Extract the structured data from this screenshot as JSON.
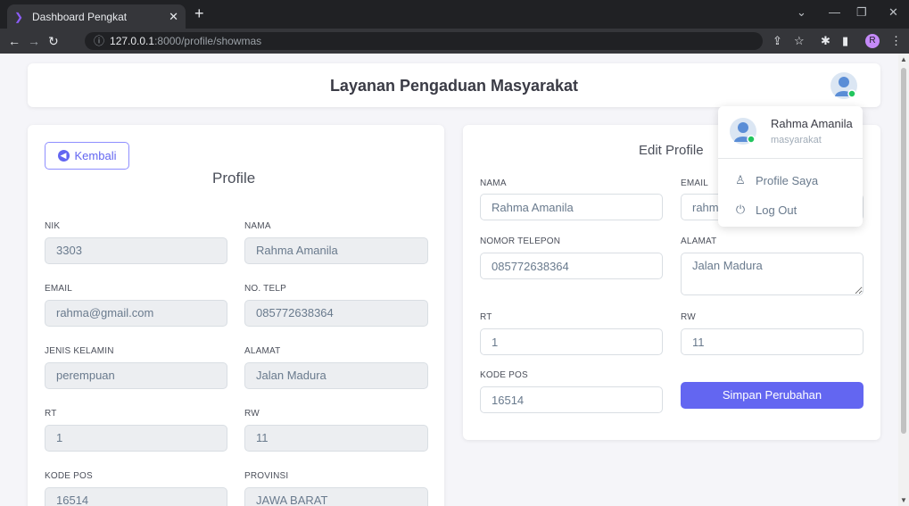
{
  "browser": {
    "tab_title": "Dashboard Pengkat",
    "url_host": "127.0.0.1",
    "url_path": ":8000/profile/showmas",
    "profile_initial": "R"
  },
  "navbar": {
    "title": "Layanan Pengaduan Masyarakat"
  },
  "profile_card": {
    "back_label": "Kembali",
    "title": "Profile",
    "fields": {
      "nik_label": "NIK",
      "nik": "3303",
      "nama_label": "NAMA",
      "nama": "Rahma Amanila",
      "email_label": "EMAIL",
      "email": "rahma@gmail.com",
      "telp_label": "NO. TELP",
      "telp": "085772638364",
      "jk_label": "JENIS KELAMIN",
      "jk": "perempuan",
      "alamat_label": "ALAMAT",
      "alamat": "Jalan Madura",
      "rt_label": "RT",
      "rt": "1",
      "rw_label": "RW",
      "rw": "11",
      "kodepos_label": "KODE POS",
      "kodepos": "16514",
      "provinsi_label": "PROVINSI",
      "provinsi": "JAWA BARAT"
    }
  },
  "edit_card": {
    "title": "Edit Profile",
    "nama_label": "NAMA",
    "nama": "Rahma Amanila",
    "email_label": "EMAIL",
    "email": "rahma@gmail.com",
    "telp_label": "NOMOR TELEPON",
    "telp": "085772638364",
    "alamat_label": "ALAMAT",
    "alamat": "Jalan Madura",
    "rt_label": "RT",
    "rt": "1",
    "rw_label": "RW",
    "rw": "11",
    "kodepos_label": "KODE POS",
    "kodepos": "16514",
    "save_label": "Simpan Perubahan"
  },
  "dropdown": {
    "name": "Rahma Amanila",
    "role": "masyarakat",
    "items": [
      {
        "label": "Profile Saya",
        "icon": "user-icon"
      },
      {
        "label": "Log Out",
        "icon": "power-icon"
      }
    ]
  },
  "colors": {
    "accent": "#6366f1",
    "status_online": "#22c55e"
  }
}
